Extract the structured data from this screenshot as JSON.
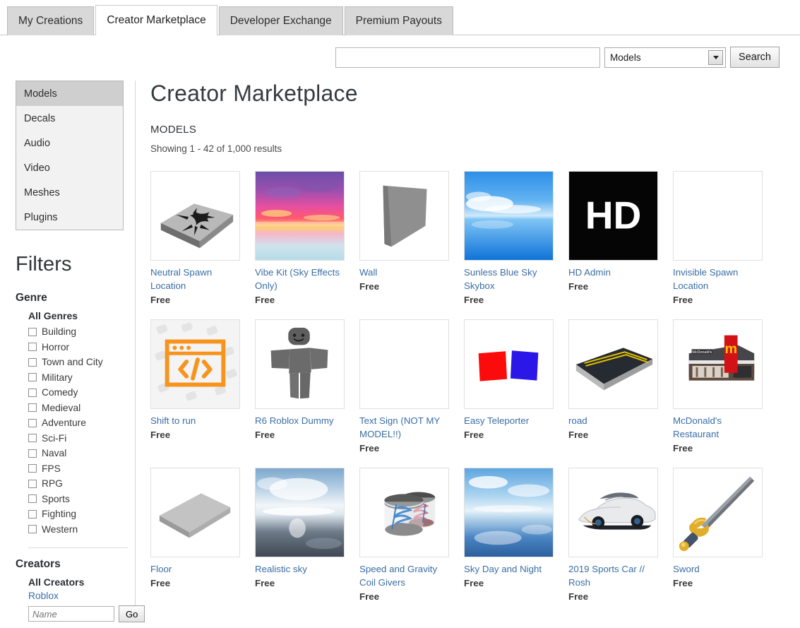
{
  "tabs": [
    {
      "label": "My Creations",
      "active": false
    },
    {
      "label": "Creator Marketplace",
      "active": true
    },
    {
      "label": "Developer Exchange",
      "active": false
    },
    {
      "label": "Premium Payouts",
      "active": false
    }
  ],
  "search": {
    "value": "",
    "placeholder": "",
    "category_selected": "Models",
    "button_label": "Search"
  },
  "sidebar": {
    "categories": [
      {
        "label": "Models",
        "active": true
      },
      {
        "label": "Decals",
        "active": false
      },
      {
        "label": "Audio",
        "active": false
      },
      {
        "label": "Video",
        "active": false
      },
      {
        "label": "Meshes",
        "active": false
      },
      {
        "label": "Plugins",
        "active": false
      }
    ],
    "filters_title": "Filters",
    "genre": {
      "title": "Genre",
      "all_label": "All Genres",
      "options": [
        "Building",
        "Horror",
        "Town and City",
        "Military",
        "Comedy",
        "Medieval",
        "Adventure",
        "Sci-Fi",
        "Naval",
        "FPS",
        "RPG",
        "Sports",
        "Fighting",
        "Western"
      ]
    },
    "creators": {
      "title": "Creators",
      "all_label": "All Creators",
      "roblox_label": "Roblox",
      "name_placeholder": "Name",
      "go_label": "Go"
    }
  },
  "main": {
    "page_title": "Creator Marketplace",
    "section_label": "MODELS",
    "results_text": "Showing 1 - 42 of 1,000 results",
    "items": [
      {
        "title": "Neutral Spawn Location",
        "price": "Free",
        "thumb": "spawn-location-thumb"
      },
      {
        "title": "Vibe Kit (Sky Effects Only)",
        "price": "Free",
        "thumb": "vibe-sky-thumb"
      },
      {
        "title": "Wall",
        "price": "Free",
        "thumb": "wall-thumb"
      },
      {
        "title": "Sunless Blue Sky Skybox",
        "price": "Free",
        "thumb": "blue-sky-thumb"
      },
      {
        "title": "HD Admin",
        "price": "Free",
        "thumb": "hd-admin-thumb"
      },
      {
        "title": "Invisible Spawn Location",
        "price": "Free",
        "thumb": "blank-thumb"
      },
      {
        "title": "Shift to run",
        "price": "Free",
        "thumb": "script-window-thumb"
      },
      {
        "title": "R6 Roblox Dummy",
        "price": "Free",
        "thumb": "dummy-thumb"
      },
      {
        "title": "Text Sign (NOT MY MODEL!!)",
        "price": "Free",
        "thumb": "blank-thumb"
      },
      {
        "title": "Easy Teleporter",
        "price": "Free",
        "thumb": "teleporter-thumb"
      },
      {
        "title": "road",
        "price": "Free",
        "thumb": "road-thumb"
      },
      {
        "title": "McDonald's Restaurant",
        "price": "Free",
        "thumb": "mcdonalds-thumb"
      },
      {
        "title": "Floor",
        "price": "Free",
        "thumb": "floor-thumb"
      },
      {
        "title": "Realistic sky",
        "price": "Free",
        "thumb": "realistic-sky-thumb"
      },
      {
        "title": "Speed and Gravity Coil Givers",
        "price": "Free",
        "thumb": "coil-givers-thumb"
      },
      {
        "title": "Sky Day and Night",
        "price": "Free",
        "thumb": "day-night-sky-thumb"
      },
      {
        "title": "2019 Sports Car // Rosh",
        "price": "Free",
        "thumb": "sports-car-thumb"
      },
      {
        "title": "Sword",
        "price": "Free",
        "thumb": "sword-thumb"
      }
    ]
  },
  "colors": {
    "link": "#3a6ea5",
    "tab_inactive_bg": "#d8d8d8",
    "active_nav_bg": "#cfcfcf",
    "accent_orange": "#f7941e"
  }
}
